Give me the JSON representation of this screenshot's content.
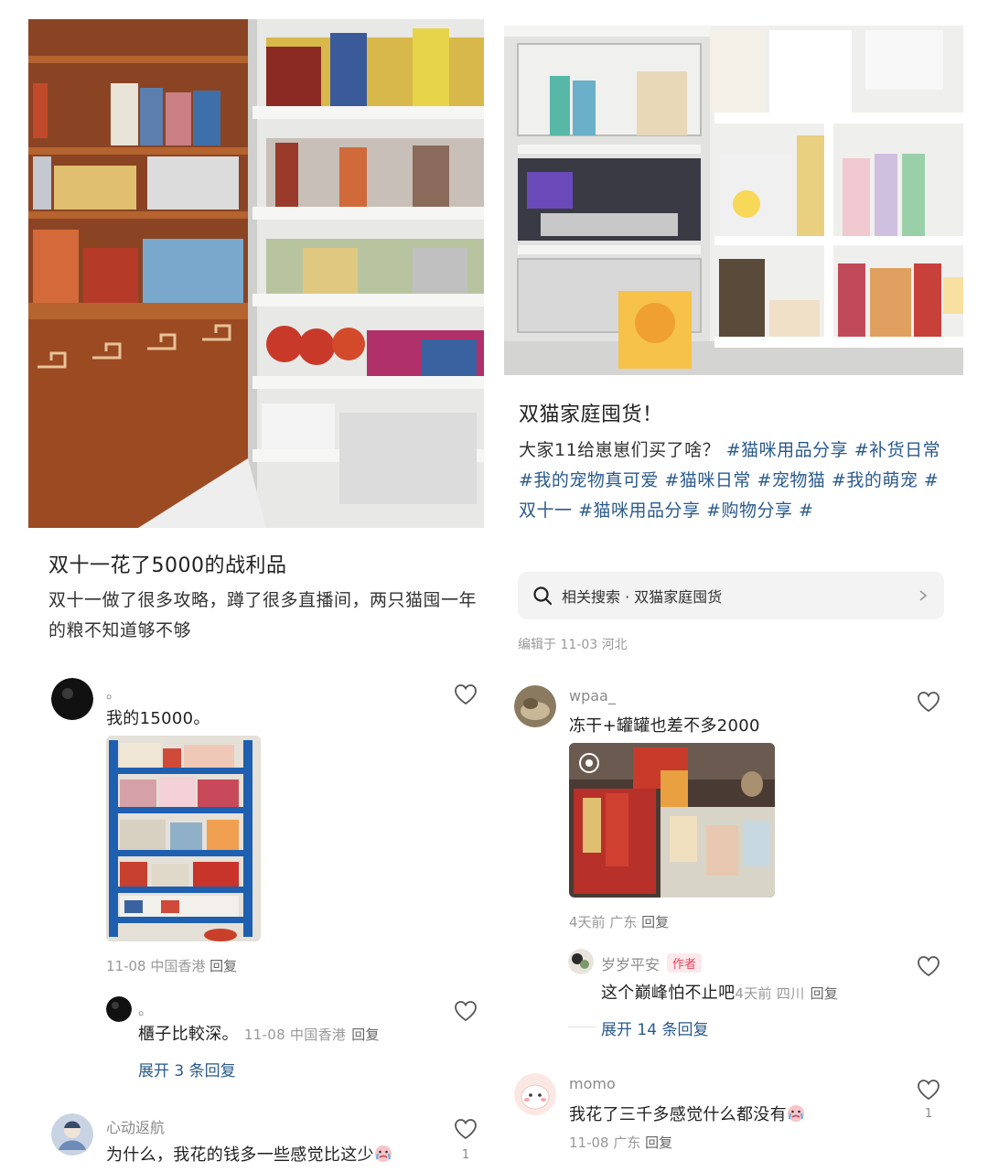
{
  "left_post": {
    "title": "双十一花了5000的战利品",
    "desc": "双十一做了很多攻略，蹲了很多直播间，两只猫囤一年的粮不知道够不够"
  },
  "right_post": {
    "title": "双猫家庭囤货！",
    "desc_prefix": "大家11给崽崽们买了啥？",
    "tags": [
      "#猫咪用品分享",
      "#补货日常",
      "#我的宠物真可爱",
      "#猫咪日常",
      "#宠物猫",
      "#我的萌宠",
      "#双十一",
      "#猫咪用品分享",
      "#购物分享",
      "#"
    ],
    "search_text": "相关搜索 · 双猫家庭囤货",
    "edited": "编辑于 11-03 河北"
  },
  "left_comments": [
    {
      "name": "。",
      "text": "我的15000。",
      "meta": "11-08 中国香港",
      "reply": "回复"
    },
    {
      "name": "。",
      "text": "櫃子比較深。",
      "meta": "11-08 中国香港",
      "reply": "回复",
      "expand": "展开 3 条回复"
    },
    {
      "name": "心动返航",
      "text": "为什么，我花的钱多一些感觉比这少",
      "likes": "1"
    }
  ],
  "right_comments": [
    {
      "name": "wpaa_",
      "text": "冻干+罐罐也差不多2000",
      "meta": "4天前 广东",
      "reply": "回复"
    },
    {
      "name": "岁岁平安",
      "author_tag": "作者",
      "text": "这个巅峰怕不止吧",
      "meta": "4天前 四川",
      "reply": "回复",
      "expand": "展开 14 条回复"
    },
    {
      "name": "momo",
      "text": "我花了三千多感觉什么都没有",
      "meta": "11-08 广东",
      "reply": "回复",
      "likes": "1"
    }
  ]
}
